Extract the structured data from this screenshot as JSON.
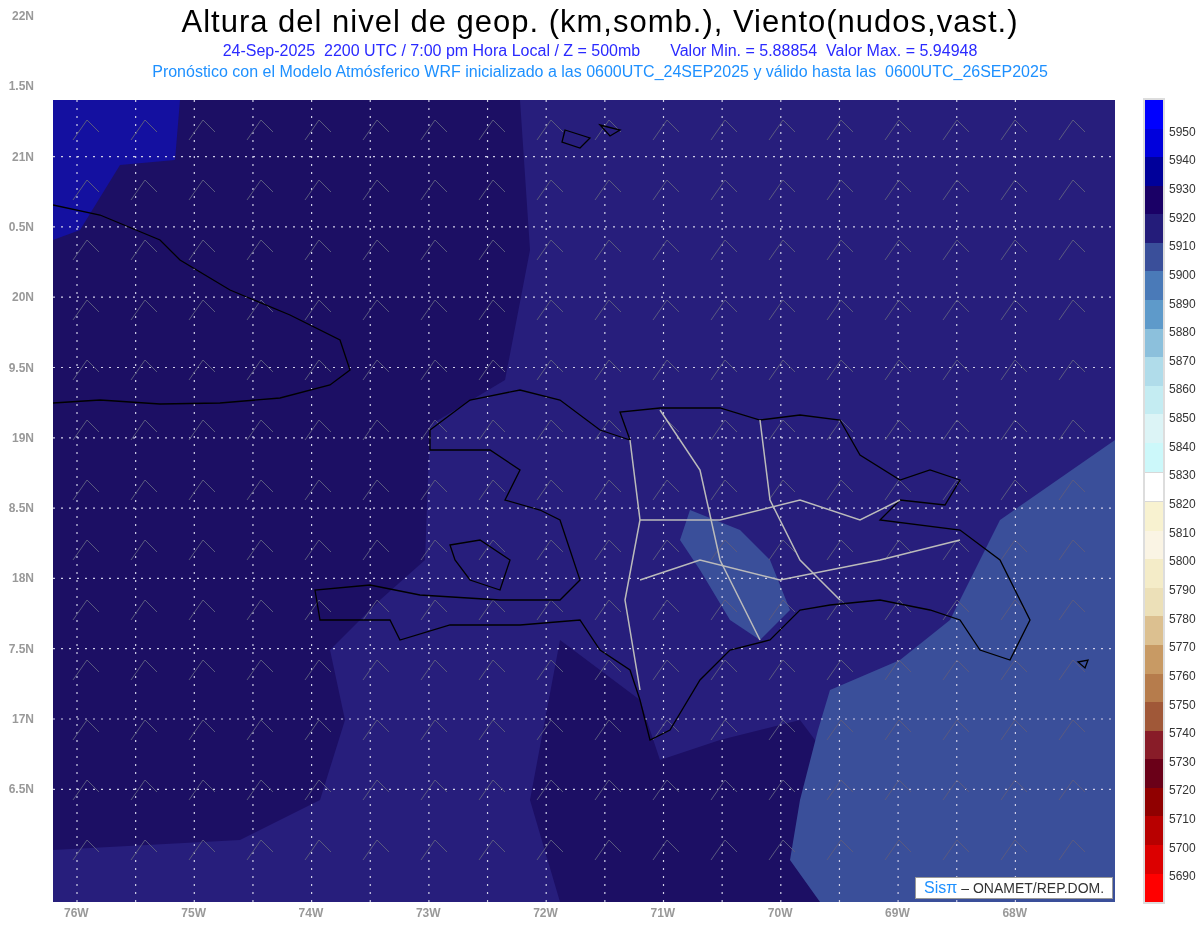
{
  "title": "Altura del nivel de geop. (km,somb.), Viento(nudos,vast.)",
  "subtitle": [
    "24-Sep-2025  2200 UTC / 7:00 pm Hora Local / Z = 500mb",
    "Valor Min. = 5.88854  Valor Max. = 5.94948"
  ],
  "forecast_note": "Pronóstico con el Modelo Atmósferico WRF inicializado a las 0600UTC_24SEP2025 y válido hasta las  0600UTC_26SEP2025",
  "map": {
    "lat_labels": [
      "22N",
      "1.5N",
      "21N",
      "0.5N",
      "20N",
      "9.5N",
      "19N",
      "8.5N",
      "18N",
      "7.5N",
      "17N",
      "6.5N"
    ],
    "lon_labels": [
      "76W",
      "75W",
      "74W",
      "73W",
      "72W",
      "71W",
      "70W",
      "69W",
      "68W"
    ]
  },
  "colorbar": {
    "bins": [
      {
        "color": "#0000ff"
      },
      {
        "color": "#0000dc"
      },
      {
        "color": "#00009a"
      },
      {
        "color": "#1a0066"
      },
      {
        "color": "#241c7a"
      },
      {
        "color": "#3a4f9a"
      },
      {
        "color": "#4a7ab8"
      },
      {
        "color": "#5e9aca"
      },
      {
        "color": "#8cc0dc"
      },
      {
        "color": "#b0dcea"
      },
      {
        "color": "#c4ecf2"
      },
      {
        "color": "#dcf4f6"
      },
      {
        "color": "#ccf8fa"
      },
      {
        "color": "#ffffff"
      },
      {
        "color": "#f8f2d0"
      },
      {
        "color": "#faf4e4"
      },
      {
        "color": "#f4ecc8"
      },
      {
        "color": "#ece0b8"
      },
      {
        "color": "#dcc090"
      },
      {
        "color": "#c89a64"
      },
      {
        "color": "#b67c4c"
      },
      {
        "color": "#a05838"
      },
      {
        "color": "#881c28"
      },
      {
        "color": "#6a0018"
      },
      {
        "color": "#900000"
      },
      {
        "color": "#b80000"
      },
      {
        "color": "#dc0000"
      },
      {
        "color": "#ff0000"
      }
    ],
    "labels": [
      "5950",
      "5940",
      "5930",
      "5920",
      "5910",
      "5900",
      "5890",
      "5880",
      "5870",
      "5860",
      "5850",
      "5840",
      "5830",
      "5820",
      "5810",
      "5800",
      "5790",
      "5780",
      "5770",
      "5760",
      "5750",
      "5740",
      "5730",
      "5720",
      "5710",
      "5700",
      "5690"
    ]
  },
  "credit": {
    "logo": "Sisπ",
    "text": "– ONAMET/REP.DOM."
  }
}
